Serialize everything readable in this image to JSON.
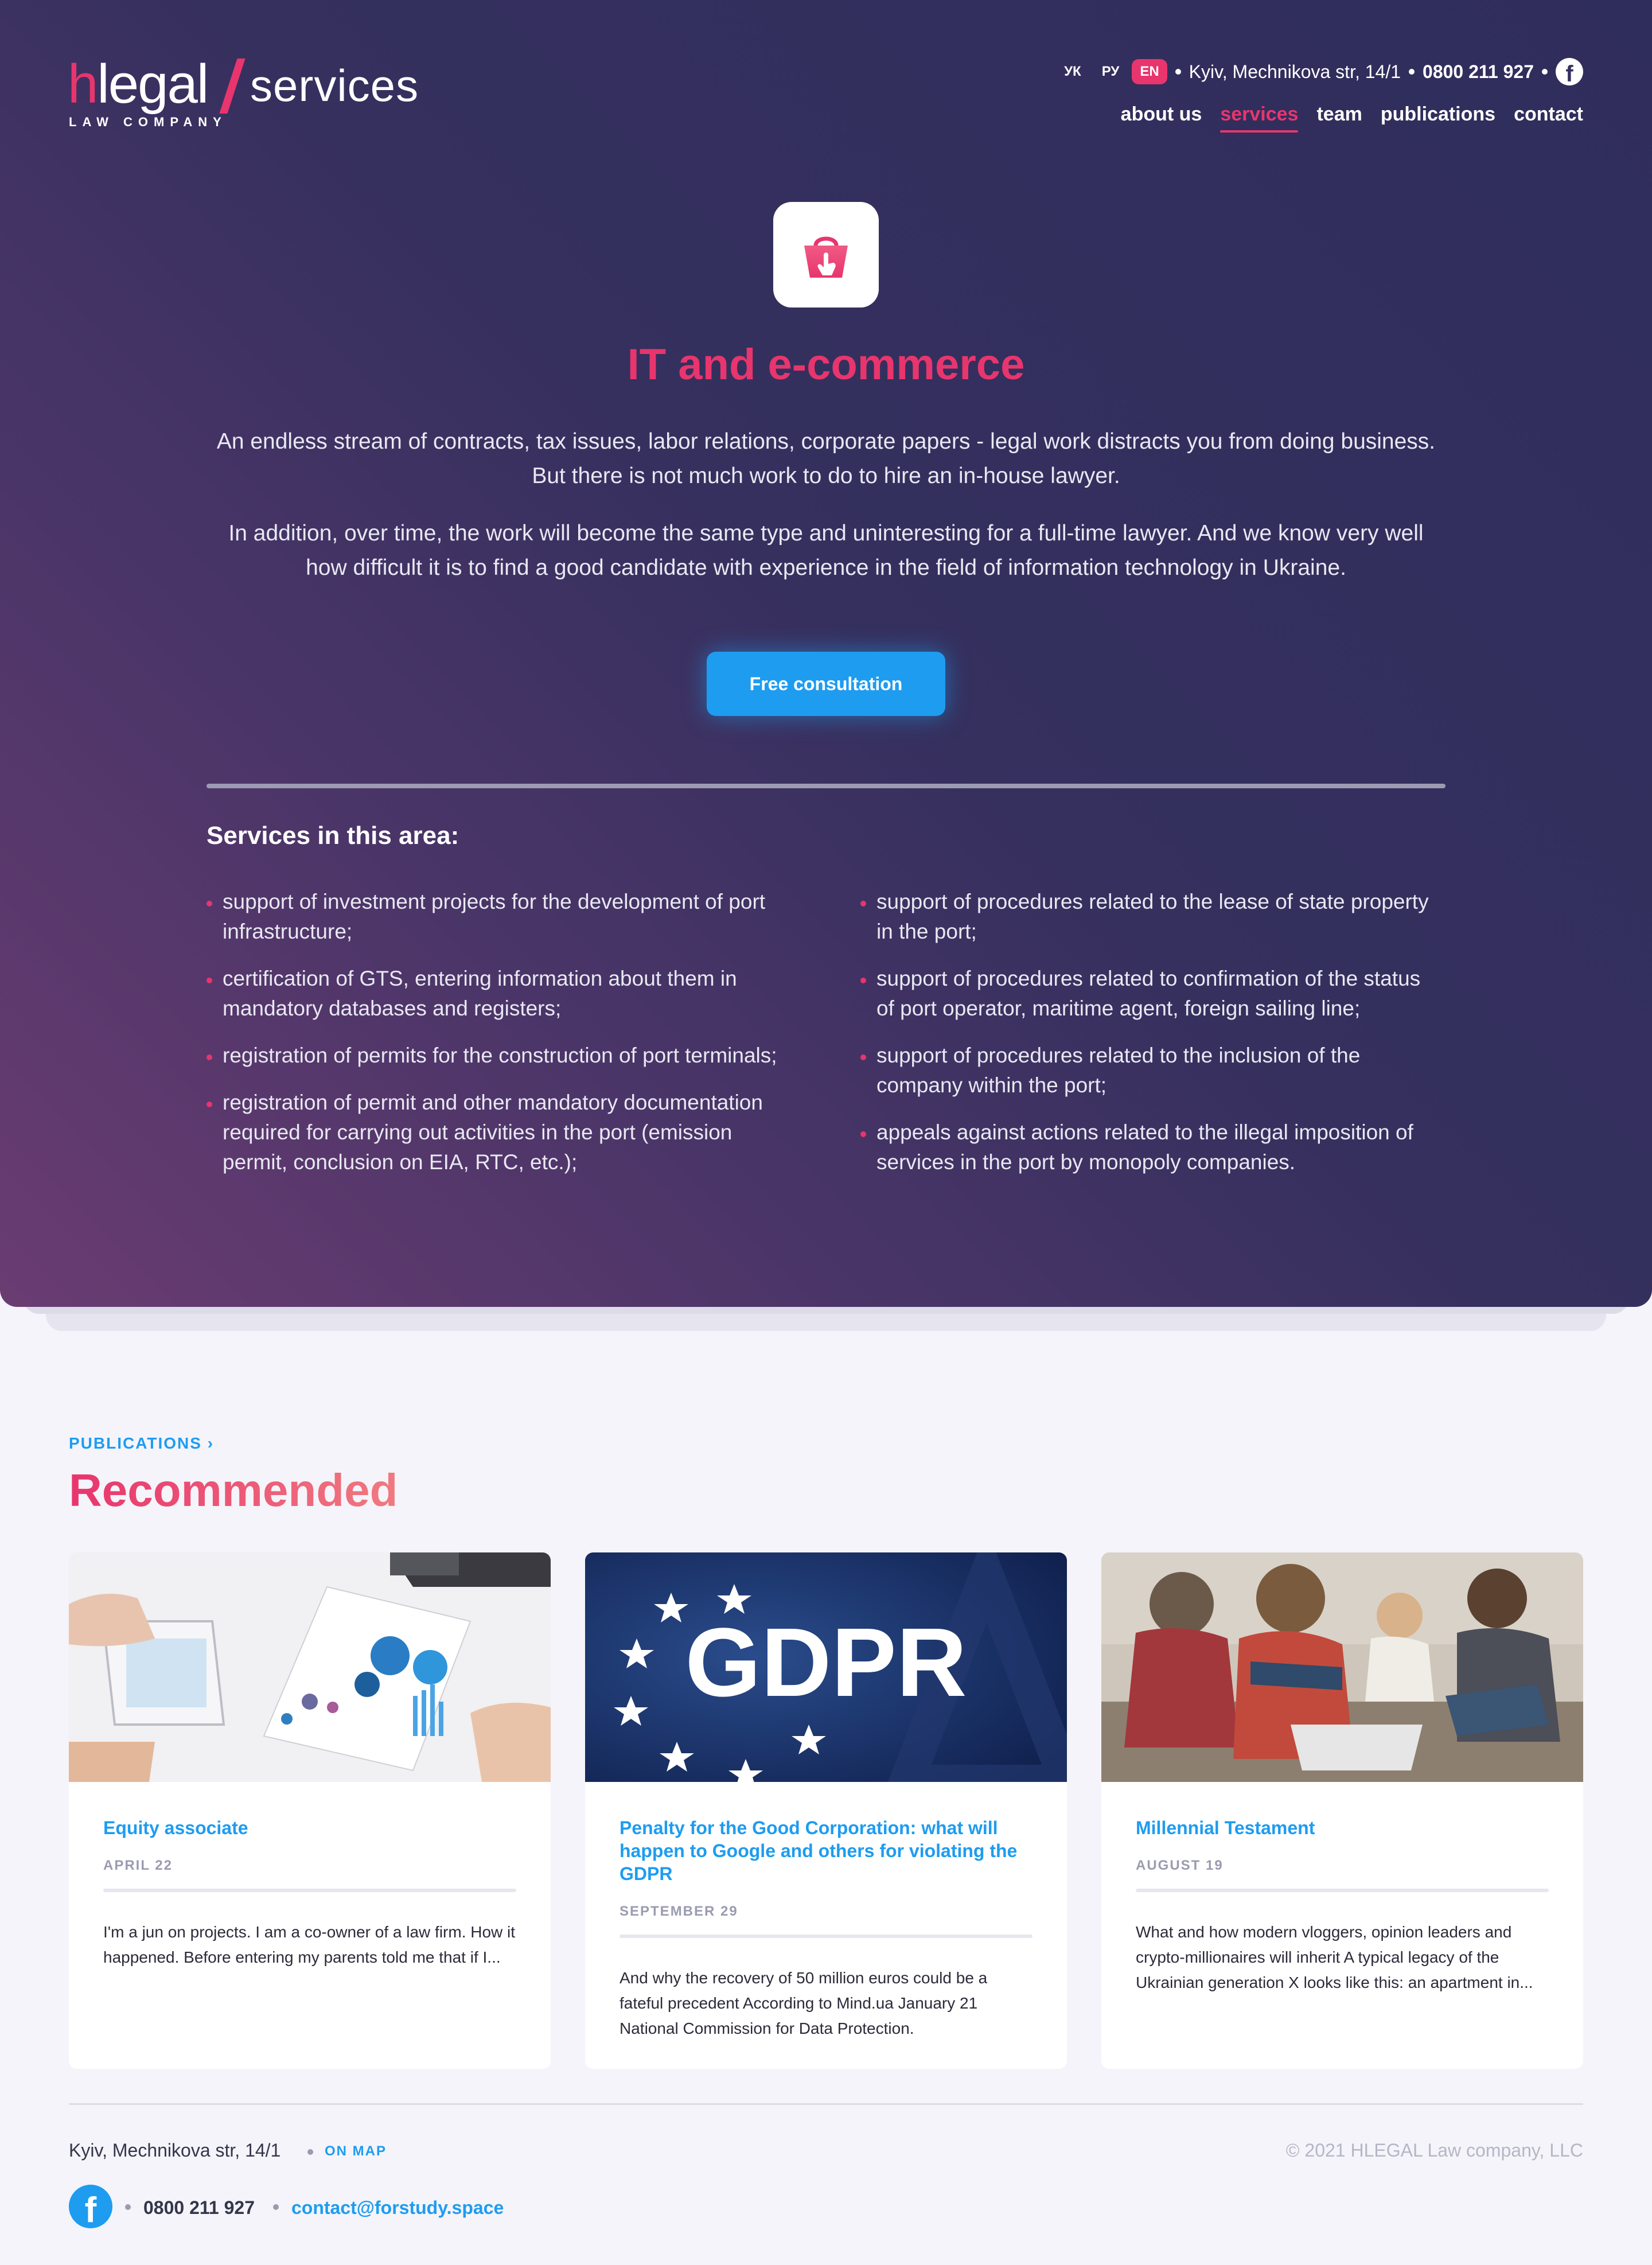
{
  "header": {
    "logo": {
      "h": "h",
      "legal": "legal",
      "services": "services",
      "subtitle": "LAW COMPANY"
    },
    "languages": [
      "УК",
      "РУ",
      "EN"
    ],
    "active_language": "EN",
    "address": "Kyiv, Mechnikova str, 14/1",
    "phone": "0800 211 927",
    "nav": [
      {
        "label": "about us",
        "active": false
      },
      {
        "label": "services",
        "active": true
      },
      {
        "label": "team",
        "active": false
      },
      {
        "label": "publications",
        "active": false
      },
      {
        "label": "contact",
        "active": false
      }
    ],
    "social_icon": "facebook-icon"
  },
  "hero": {
    "icon": "shopping-bag-icon",
    "title": "IT and e-commerce",
    "paragraph_1": "An endless stream of contracts, tax issues, labor relations, corporate papers - legal work distracts you from doing business. But there is not much work to do to hire an in-house lawyer.",
    "paragraph_2": "In addition, over time, the work will become the same type and uninteresting for a full-time lawyer. And we know very well how difficult it is to find a good candidate with experience in the field of information technology in Ukraine.",
    "cta_label": "Free consultation"
  },
  "services": {
    "heading": "Services in this area:",
    "left": [
      "support of investment projects for the development of port infrastructure;",
      "certification of GTS, entering information about them in mandatory databases and registers;",
      "registration of permits for the construction of port terminals;",
      "registration of permit and other mandatory documentation required for carrying out activities in the port (emission permit, conclusion on EIA, RTC, etc.);"
    ],
    "right": [
      "support of procedures related to the lease of state property in the port;",
      "support of procedures related to confirmation of the status of port operator, maritime agent, foreign sailing line;",
      "support of procedures related to the inclusion of the company within the port;",
      "appeals against actions related to the illegal imposition of services in the port by monopoly companies."
    ]
  },
  "publications": {
    "crumb": "PUBLICATIONS",
    "title": "Recommended",
    "cards": [
      {
        "title": "Equity associate",
        "date": "APRIL 22",
        "excerpt": "I'm a jun on projects. I am a co-owner of a law firm. How it happened. Before entering my parents told me that if I...",
        "image": "business-documents-photo"
      },
      {
        "title": "Penalty for the Good Corporation: what will happen to Google and others for violating the GDPR",
        "date": "SEPTEMBER 29",
        "excerpt": "And why the recovery of 50 million euros could be a fateful precedent According to Mind.ua January 21 National Commission for Data Protection.",
        "image": "gdpr-banner",
        "image_text": "GDPR"
      },
      {
        "title": "Millennial Testament",
        "date": "AUGUST 19",
        "excerpt": "What and how modern vloggers, opinion leaders and crypto-millionaires will inherit A typical legacy of the Ukrainian generation X looks like this: an apartment in...",
        "image": "young-people-photo"
      }
    ]
  },
  "footer": {
    "address": "Kyiv, Mechnikova str, 14/1",
    "map_link": "ON MAP",
    "copyright": "© 2021 HLEGAL Law company, LLC",
    "phone": "0800 211 927",
    "email": "contact@forstudy.space"
  },
  "colors": {
    "accent_pink": "#e8356d",
    "accent_blue": "#1e9cf0",
    "hero_dark": "#2f2d5c",
    "hero_purple": "#6a3c72",
    "page_bg": "#f4f4fa"
  }
}
